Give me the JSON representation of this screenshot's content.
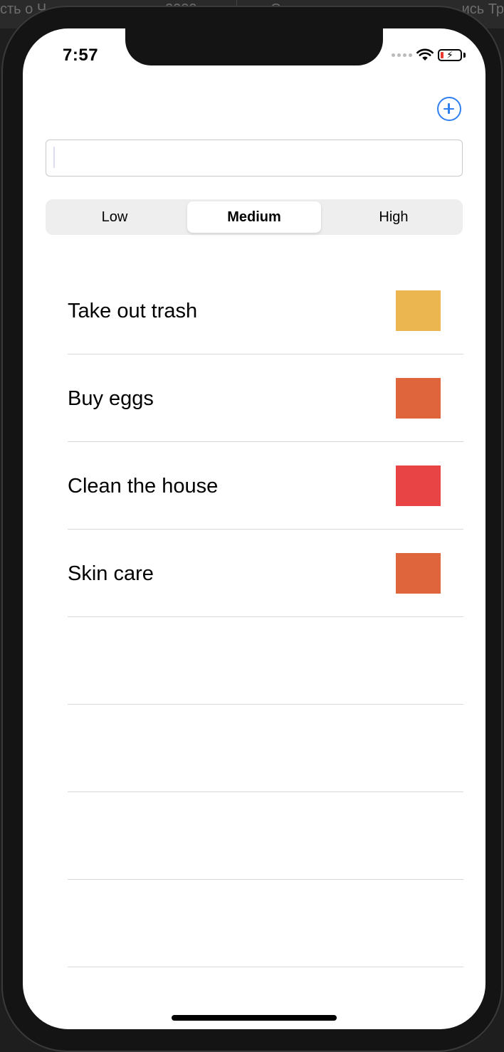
{
  "background": {
    "left_text": "сть о Ч",
    "mid_text": "2020",
    "mid2_text": "С",
    "right_text": "ись Тр"
  },
  "status_bar": {
    "time": "7:57",
    "wifi_icon": "wifi-icon",
    "battery_icon": "battery-charging-icon",
    "battery_level_color": "#e8382e"
  },
  "toolbar": {
    "add_icon": "plus-circle-icon",
    "accent_color": "#2f7ff0"
  },
  "input": {
    "value": "",
    "placeholder": ""
  },
  "priority_segments": {
    "options": [
      "Low",
      "Medium",
      "High"
    ],
    "selected": "Medium"
  },
  "tasks": [
    {
      "title": "Take out trash",
      "color": "#ebb550"
    },
    {
      "title": "Buy eggs",
      "color": "#df653c"
    },
    {
      "title": "Clean the house",
      "color": "#e84446"
    },
    {
      "title": "Skin care",
      "color": "#df653c"
    },
    {
      "title": "",
      "color": ""
    },
    {
      "title": "",
      "color": ""
    },
    {
      "title": "",
      "color": ""
    },
    {
      "title": "",
      "color": ""
    }
  ]
}
